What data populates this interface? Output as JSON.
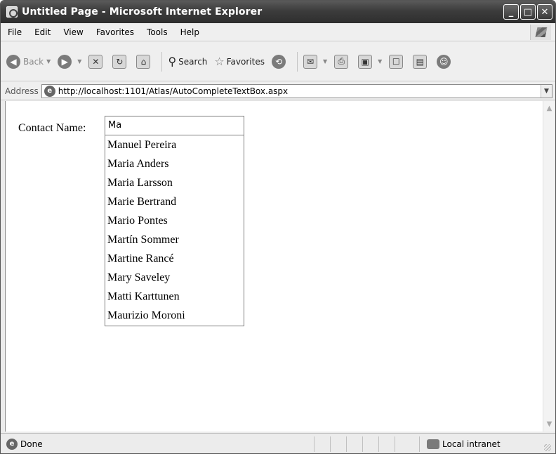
{
  "window": {
    "title": "Untitled Page - Microsoft Internet Explorer",
    "controls": {
      "minimize": "_",
      "maximize": "□",
      "close": "✕"
    }
  },
  "menu": [
    "File",
    "Edit",
    "View",
    "Favorites",
    "Tools",
    "Help"
  ],
  "toolbar": {
    "back_label": "Back",
    "search_label": "Search",
    "favorites_label": "Favorites"
  },
  "address": {
    "label": "Address",
    "url": "http://localhost:1101/Atlas/AutoCompleteTextBox.aspx"
  },
  "page": {
    "label": "Contact Name:",
    "input_value": "Ma",
    "suggestions": [
      "Manuel Pereira",
      "Maria Anders",
      "Maria Larsson",
      "Marie Bertrand",
      "Mario Pontes",
      "Martín Sommer",
      "Martine Rancé",
      "Mary Saveley",
      "Matti Karttunen",
      "Maurizio Moroni"
    ]
  },
  "status": {
    "text": "Done",
    "zone": "Local intranet"
  }
}
